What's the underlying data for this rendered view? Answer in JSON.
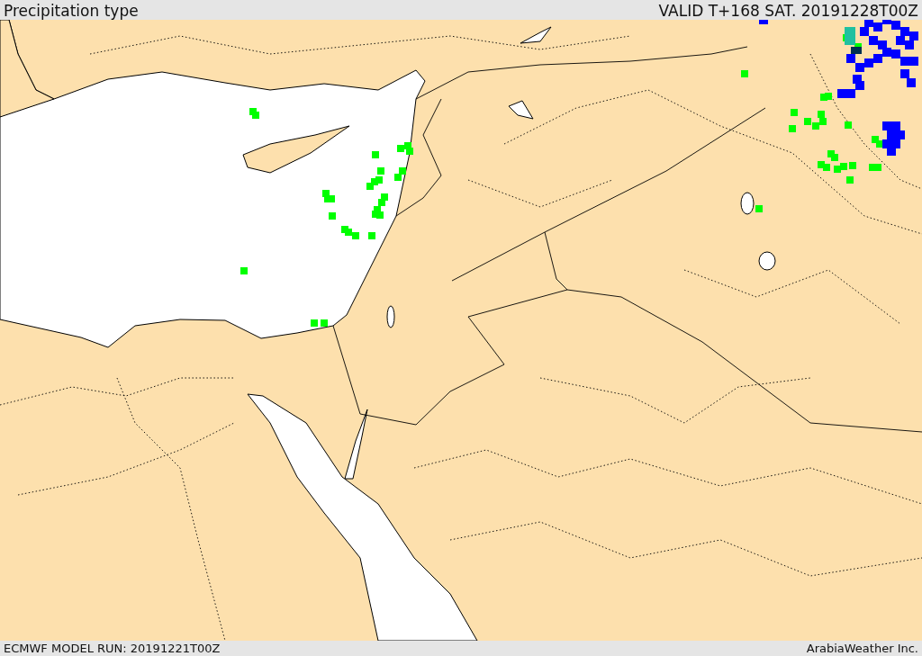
{
  "header": {
    "title": "Precipitation type",
    "valid_time": "VALID T+168 SAT. 20191228T00Z"
  },
  "footer": {
    "model_run": "ECMWF MODEL RUN: 20191221T00Z",
    "credit": "ArabiaWeather Inc."
  }
}
